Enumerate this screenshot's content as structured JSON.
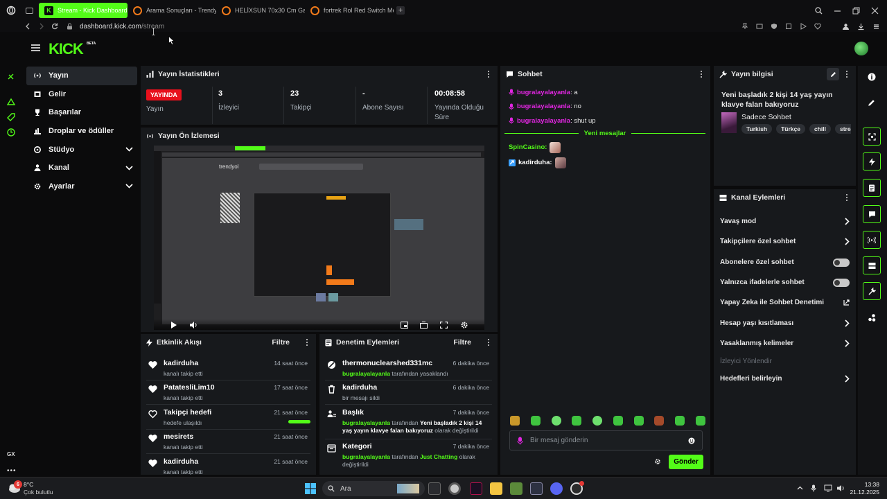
{
  "browser": {
    "tabs": [
      {
        "label": "Stream - Kick Dashboard",
        "active": true
      },
      {
        "label": "Arama Sonuçları - Trendy",
        "active": false
      },
      {
        "label": "HELİXSUN 70x30 Cm Ga",
        "active": false
      },
      {
        "label": "fortrek Rol Red Switch Me",
        "active": false
      }
    ],
    "url_host": "dashboard.kick.com",
    "url_path": "/stream"
  },
  "header": {
    "logo": "KICK",
    "beta": "BETA"
  },
  "nav": [
    {
      "label": "Yayın",
      "icon": "broadcast-icon",
      "selected": true,
      "chevron": false
    },
    {
      "label": "Gelir",
      "icon": "dollar-icon",
      "selected": false,
      "chevron": false
    },
    {
      "label": "Başarılar",
      "icon": "trophy-icon",
      "selected": false,
      "chevron": false
    },
    {
      "label": "Droplar ve ödüller",
      "icon": "gift-icon",
      "selected": false,
      "chevron": false
    },
    {
      "label": "Stüdyo",
      "icon": "studio-icon",
      "selected": false,
      "chevron": true
    },
    {
      "label": "Kanal",
      "icon": "channel-icon",
      "selected": false,
      "chevron": true
    },
    {
      "label": "Ayarlar",
      "icon": "gear-icon",
      "selected": false,
      "chevron": true
    }
  ],
  "stats": {
    "title": "Yayın İstatistikleri",
    "live_badge": "YAYINDA",
    "live_label": "Yayın",
    "viewers": "3",
    "viewers_label": "İzleyici",
    "followers": "23",
    "followers_label": "Takipçi",
    "subs": "-",
    "subs_label": "Abone Sayısı",
    "uptime": "00:08:58",
    "uptime_label": "Yayında Olduğu Süre"
  },
  "preview": {
    "title": "Yayın Ön İzlemesi",
    "site": "trendyol"
  },
  "activity": {
    "title": "Etkinlik Akışı",
    "filter": "Filtre",
    "items": [
      {
        "name": "kadirduha",
        "sub": "kanalı takip etti",
        "time": "14 saat önce",
        "icon": "heart-icon",
        "goal": false
      },
      {
        "name": "PatatesliLim10",
        "sub": "kanalı takip etti",
        "time": "17 saat önce",
        "icon": "heart-icon",
        "goal": false
      },
      {
        "name": "Takipçi hedefi",
        "sub": "hedefe ulaşıldı",
        "time": "21 saat önce",
        "icon": "heart-outline-icon",
        "goal": true
      },
      {
        "name": "mesirets",
        "sub": "kanalı takip etti",
        "time": "21 saat önce",
        "icon": "heart-icon",
        "goal": false
      },
      {
        "name": "kadirduha",
        "sub": "kanalı takip etti",
        "time": "21 saat önce",
        "icon": "heart-icon",
        "goal": false
      }
    ]
  },
  "moderation": {
    "title": "Denetim Eylemleri",
    "filter": "Filtre",
    "items": [
      {
        "name": "thermonuclearshed331mc",
        "time": "6 dakika önce",
        "icon": "ban-icon",
        "actor": "bugralayalayanla",
        "text": " tarafından yasaklandı",
        "value": "",
        "tail": ""
      },
      {
        "name": "kadirduha",
        "time": "6 dakika önce",
        "icon": "trash-icon",
        "actor": "",
        "text": "bir mesajı sildi",
        "value": "",
        "tail": ""
      },
      {
        "name": "Başlık",
        "time": "7 dakika önce",
        "icon": "title-icon",
        "actor": "bugralayalayanla",
        "text": " tarafından ",
        "value": "Yeni başladık 2 kişi 14 yaş yayın klavye falan bakıyoruz",
        "tail": " olarak değiştirildi"
      },
      {
        "name": "Kategori",
        "time": "7 dakika önce",
        "icon": "category-icon",
        "actor": "bugralayalayanla",
        "text": " tarafından ",
        "value": "Just Chatting",
        "tail": " olarak değiştirildi"
      }
    ]
  },
  "chat": {
    "title": "Sohbet",
    "messages": [
      {
        "user": "bugralayalayanla",
        "text": ": a"
      },
      {
        "user": "bugralayalayanla",
        "text": ": no"
      },
      {
        "user": "bugralayalayanla",
        "text": ": shut up"
      }
    ],
    "new_messages": "Yeni mesajlar",
    "new": [
      {
        "user": "SpinCasino:",
        "color": "#53fc18"
      },
      {
        "user": "kadirduha:",
        "color": "#ffffff"
      }
    ],
    "placeholder": "Bir mesaj gönderin",
    "send": "Gönder"
  },
  "stream_info": {
    "title": "Yayın bilgisi",
    "stream_title": "Yeni başladık 2 kişi 14 yaş yayın klavye falan bakıyoruz",
    "category": "Sadece Sohbet",
    "tags": [
      "Turkish",
      "Türkçe",
      "chill",
      "streame"
    ]
  },
  "channel_actions": {
    "title": "Kanal Eylemleri",
    "items": [
      {
        "label": "Yavaş mod",
        "control": "chevron"
      },
      {
        "label": "Takipçilere özel sohbet",
        "control": "chevron"
      },
      {
        "label": "Abonelere özel sohbet",
        "control": "toggle"
      },
      {
        "label": "Yalnızca ifadelerle sohbet",
        "control": "toggle"
      },
      {
        "label": "Yapay Zeka ile Sohbet Denetimi",
        "control": "external"
      },
      {
        "label": "Hesap yaşı kısıtlaması",
        "control": "chevron"
      },
      {
        "label": "Yasaklanmış kelimeler",
        "control": "chevron"
      },
      {
        "label": "İzleyici Yönlendir",
        "control": "disabled"
      },
      {
        "label": "Hedefleri belirleyin",
        "control": "chevron"
      }
    ]
  },
  "taskbar": {
    "weather_temp": "8°C",
    "weather_desc": "Çok bulutlu",
    "weather_badge": "6",
    "search": "Ara",
    "time": "13:38",
    "date": "21.12.2025"
  },
  "gx_label": "GX",
  "colors": {
    "accent": "#53fc18",
    "chat_user": "#e226e2",
    "panel": "#17191c",
    "bg": "#0b0b0c"
  }
}
